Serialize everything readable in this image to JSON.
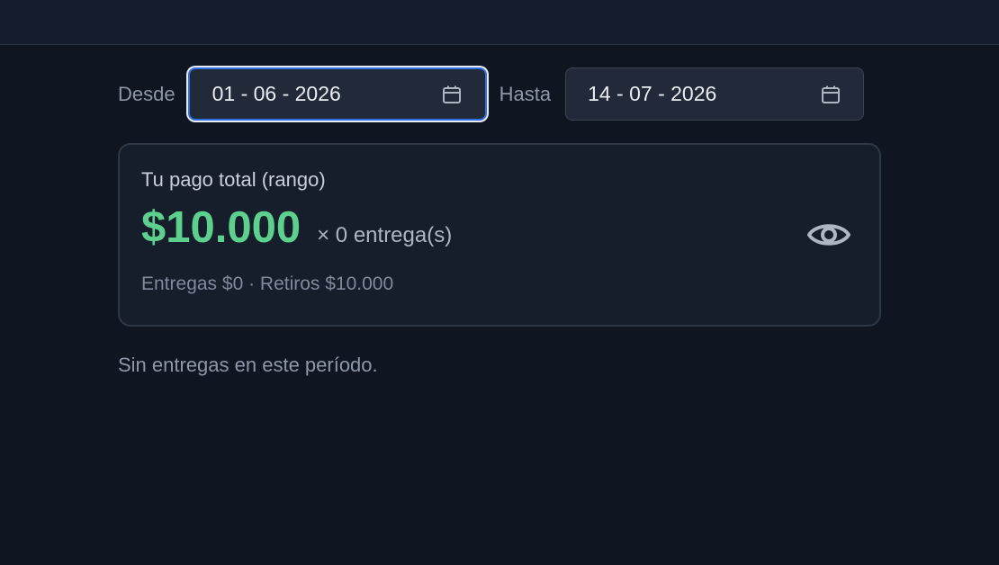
{
  "range": {
    "from_label": "Desde",
    "from_value": "01 - 06 - 2026",
    "to_label": "Hasta",
    "to_value": "14 - 07 - 2026"
  },
  "summary": {
    "title": "Tu pago total (rango)",
    "amount": "$10.000",
    "deliveries": "× 0 entrega(s)",
    "breakdown": "Entregas $0 · Retiros $10.000",
    "toggle_icon": "eye-icon"
  },
  "empty_message": "Sin entregas en este período.",
  "colors": {
    "background": "#0f1622",
    "accent_focus": "#2f6fe6",
    "amount_green": "#5ed08e"
  }
}
